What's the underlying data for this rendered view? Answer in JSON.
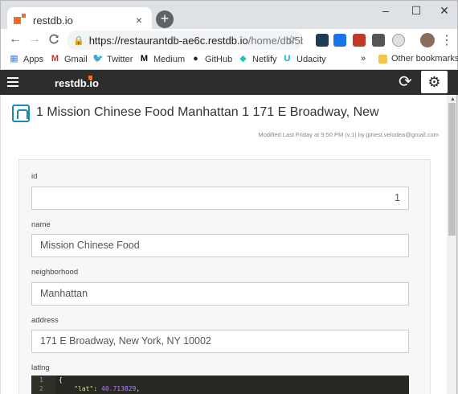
{
  "browser": {
    "tab_title": "restdb.io",
    "tab_close": "×",
    "new_tab": "+",
    "window_controls": [
      "–",
      "☐",
      "✕"
    ],
    "url_main": "https://restaurantdb-ae6c.restdb.io",
    "url_path": "/home/db/5bc...",
    "nav": {
      "back": "←",
      "forward": "→",
      "reload": "C"
    },
    "star": "☆",
    "menu": "⋮",
    "extensions": [
      {
        "name": "extension-1-icon",
        "color": "#1f3a57"
      },
      {
        "name": "extension-2-icon",
        "color": "#1a73e8"
      },
      {
        "name": "ublock-icon",
        "color": "#c0392b"
      },
      {
        "name": "extension-4-icon",
        "color": "#555555"
      },
      {
        "name": "extension-5-icon",
        "color": "#e0e0e0"
      }
    ]
  },
  "bookmarks": {
    "items": [
      {
        "label": "Apps",
        "icon": "apps-grid-icon",
        "color": "#4285f4",
        "glyph": "▦"
      },
      {
        "label": "Gmail",
        "icon": "gmail-icon",
        "color": "#d93025",
        "glyph": "M"
      },
      {
        "label": "Twitter",
        "icon": "twitter-icon",
        "color": "#1da1f2",
        "glyph": "🐦"
      },
      {
        "label": "Medium",
        "icon": "medium-icon",
        "color": "#000000",
        "glyph": "M"
      },
      {
        "label": "GitHub",
        "icon": "github-icon",
        "color": "#24292e",
        "glyph": "●"
      },
      {
        "label": "Netlify",
        "icon": "netlify-icon",
        "color": "#20c6b7",
        "glyph": "◆"
      },
      {
        "label": "Udacity",
        "icon": "udacity-icon",
        "color": "#02b3e4",
        "glyph": "U"
      }
    ],
    "overflow": "»",
    "other": "Other bookmarks"
  },
  "app": {
    "logo": "restdb.io",
    "refresh": "⟳",
    "settings": "⚙"
  },
  "record": {
    "title": "1 Mission Chinese Food Manhattan 1 171 E Broadway, New",
    "modified": "Modified Last Friday at 9:50 PM (v.1) by jpriest.velodea@gmail.com"
  },
  "fields": [
    {
      "label": "id",
      "value": "1"
    },
    {
      "label": "name",
      "value": "Mission Chinese Food"
    },
    {
      "label": "neighborhood",
      "value": "Manhattan"
    },
    {
      "label": "address",
      "value": "171 E Broadway, New York, NY 10002"
    }
  ],
  "latlng": {
    "label": "latlng",
    "line_numbers": [
      "1",
      "2"
    ],
    "line1": "{",
    "key": "\"lat\"",
    "colon": ": ",
    "value": "40.713829",
    "comma": ","
  }
}
